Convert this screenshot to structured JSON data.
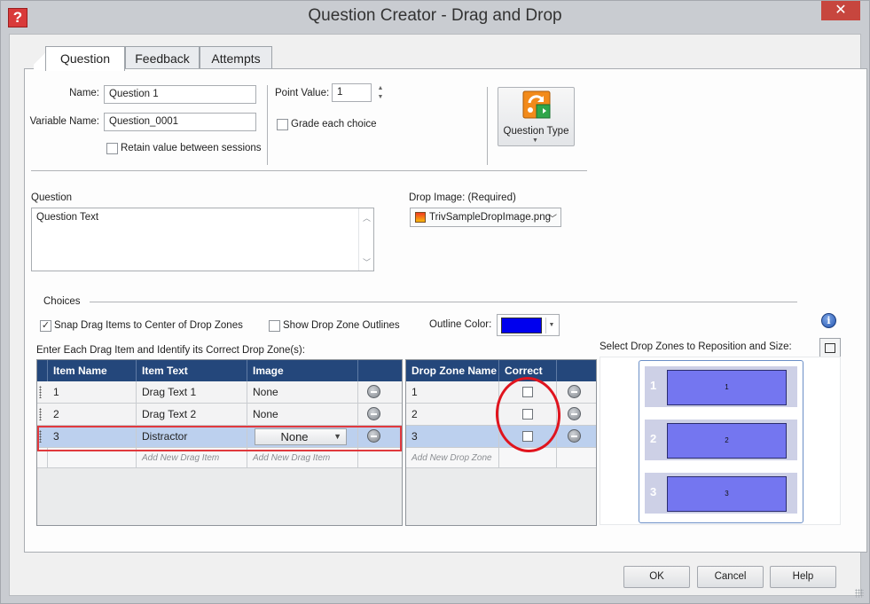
{
  "window": {
    "title": "Question Creator - Drag and Drop",
    "close_glyph": "✕",
    "app_icon_glyph": "?"
  },
  "tabs": [
    {
      "label": "Question"
    },
    {
      "label": "Feedback"
    },
    {
      "label": "Attempts"
    }
  ],
  "form": {
    "name_label": "Name:",
    "name_value": "Question 1",
    "variable_label": "Variable Name:",
    "variable_value": "Question_0001",
    "retain_label": "Retain value between sessions",
    "point_value_label": "Point Value:",
    "point_value": "1",
    "grade_each_label": "Grade each choice",
    "question_type_label": "Question Type"
  },
  "question": {
    "label": "Question",
    "text": "Question Text"
  },
  "drop_image": {
    "label": "Drop Image: (Required)",
    "value": "TrivSampleDropImage.png"
  },
  "choices": {
    "section_label": "Choices",
    "snap_label": "Snap Drag Items to Center of Drop Zones",
    "snap_checked": true,
    "outlines_label": "Show Drop Zone Outlines",
    "outlines_checked": false,
    "outline_color_label": "Outline Color:",
    "outline_color": "#0000ee",
    "instruction": "Enter Each Drag Item and Identify its Correct Drop Zone(s):",
    "zones_instruction": "Select Drop Zones to Reposition and Size:"
  },
  "items_table": {
    "headers": [
      "Item Name",
      "Item Text",
      "Image"
    ],
    "rows": [
      {
        "name": "1",
        "text": "Drag Text 1",
        "image": "None"
      },
      {
        "name": "2",
        "text": "Drag Text 2",
        "image": "None"
      },
      {
        "name": "3",
        "text": "Distractor",
        "image": "None"
      }
    ],
    "add_item_placeholder": "Add New Drag Item",
    "add_image_placeholder": "Add New Drag Item"
  },
  "zones_table": {
    "headers": [
      "Drop Zone Name",
      "Correct"
    ],
    "rows": [
      {
        "name": "1",
        "correct": false
      },
      {
        "name": "2",
        "correct": false
      },
      {
        "name": "3",
        "correct": false
      }
    ],
    "add_zone_placeholder": "Add New Drop Zone"
  },
  "zone_preview": [
    {
      "number": "1",
      "label": "1"
    },
    {
      "number": "2",
      "label": "2"
    },
    {
      "number": "3",
      "label": "3"
    }
  ],
  "buttons": {
    "ok": "OK",
    "cancel": "Cancel",
    "help": "Help"
  },
  "icons": {
    "app": "help-question-icon",
    "question_type": "question-type-icon",
    "info": "info-icon",
    "fit": "fit-to-frame-icon",
    "file": "image-file-icon",
    "remove": "remove-row-icon"
  }
}
